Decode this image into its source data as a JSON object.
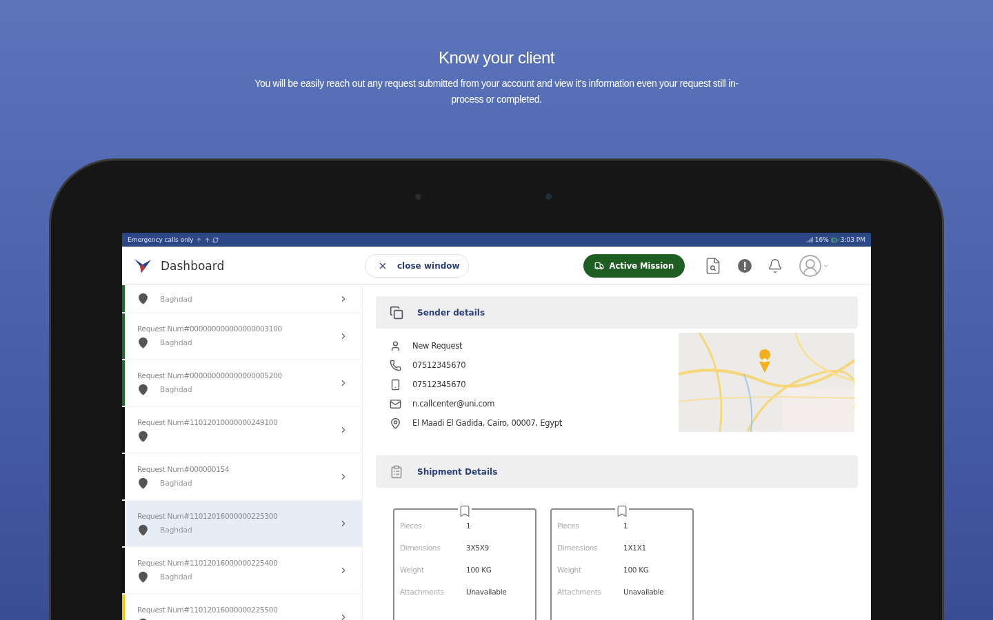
{
  "hero": {
    "title": "Know your client",
    "subtitle": "You will be easily reach out any request submitted from your account and view it's information even your request still in-process or completed."
  },
  "status_bar": {
    "left": "Emergency calls only",
    "battery": "16%",
    "time": "3:03 PM"
  },
  "app_bar": {
    "title": "Dashboard",
    "close_button": "close window",
    "mission_button": "Active Mission"
  },
  "requests": [
    {
      "city": "Baghdad",
      "color": "#1f6b2c",
      "selected": false
    },
    {
      "title": "Request Num#000000000000000003100",
      "city": "Baghdad",
      "color": "#1f6b2c",
      "selected": false
    },
    {
      "title": "Request Num#000000000000000005200",
      "city": "Baghdad",
      "color": "#1f6b2c",
      "selected": false
    },
    {
      "title": "Request Num#11012010000000249100",
      "color": "#111111",
      "selected": false
    },
    {
      "title": "Request Num#000000154",
      "city": "Baghdad",
      "color": "#111111",
      "selected": false
    },
    {
      "title": "Request Num#11012016000000225300",
      "city": "Baghdad",
      "color": "#111111",
      "selected": true
    },
    {
      "title": "Request Num#11012016000000225400",
      "city": "Baghdad",
      "color": "#111111",
      "selected": false
    },
    {
      "title": "Request Num#11012016000000225500",
      "color": "#f5c518",
      "selected": false
    }
  ],
  "sender": {
    "title": "Sender details",
    "contacts": [
      {
        "kind": "person",
        "text": "New Request"
      },
      {
        "kind": "phone",
        "text": "07512345670"
      },
      {
        "kind": "mobile",
        "text": "07512345670"
      },
      {
        "kind": "email",
        "text": "n.callcenter@uni.com"
      },
      {
        "kind": "address",
        "text": "El Maadi El Gadida, Cairo, 00007, Egypt"
      }
    ]
  },
  "shipment": {
    "title": "Shipment Details",
    "packages": [
      {
        "fields": [
          {
            "label": "Pieces",
            "value": "1"
          },
          {
            "label": "Dimensions",
            "value": "3X5X9"
          },
          {
            "label": "Weight",
            "value": "100 KG"
          },
          {
            "label": "Attachments",
            "value": "Unavailable"
          }
        ]
      },
      {
        "fields": [
          {
            "label": "Pieces",
            "value": "1"
          },
          {
            "label": "Dimensions",
            "value": "1X1X1"
          },
          {
            "label": "Weight",
            "value": "100 KG"
          },
          {
            "label": "Attachments",
            "value": "Unavailable"
          }
        ]
      }
    ]
  }
}
